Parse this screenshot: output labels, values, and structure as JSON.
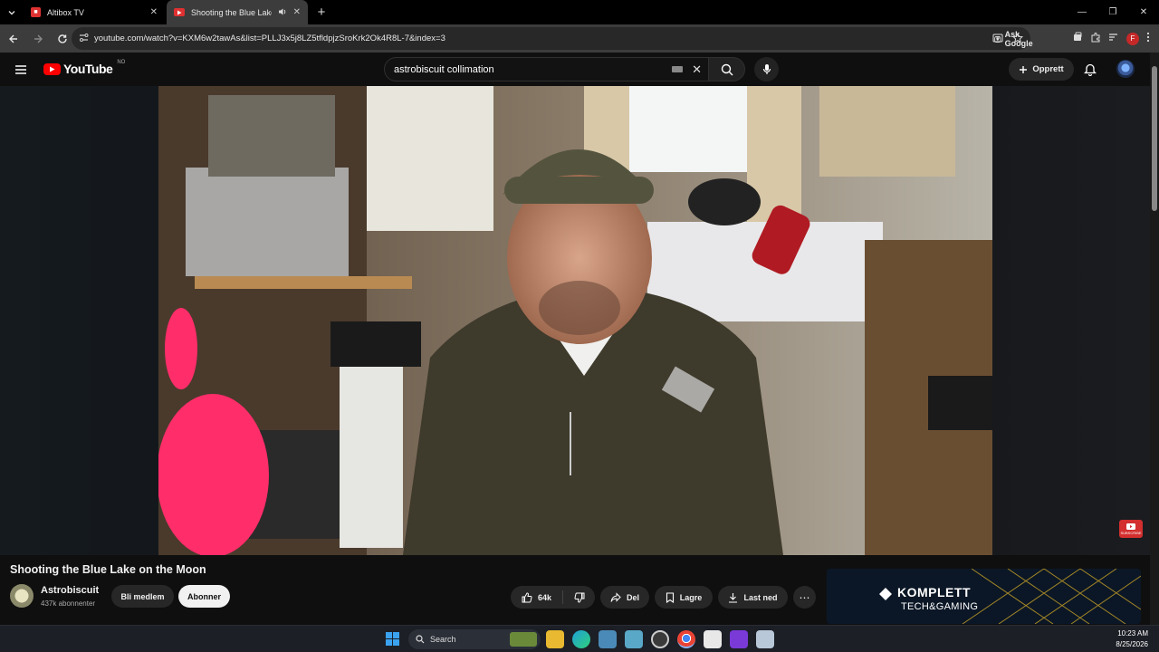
{
  "browser": {
    "tabs": [
      {
        "title": "Altibox TV",
        "active": false
      },
      {
        "title": "Shooting the Blue Lake on",
        "active": true
      }
    ],
    "url": "youtube.com/watch?v=KXM6w2tawAs&list=PLLJ3x5j8LZ5tfldpjzSroKrk2Ok4R8L-7&index=3",
    "ask_google_label": "Ask Google",
    "profile_initial": "F"
  },
  "youtube": {
    "logo_text": "YouTube",
    "country_code": "NO",
    "search_value": "astrobiscuit collimation",
    "create_label": "Opprett"
  },
  "video": {
    "title": "Shooting the Blue Lake on the Moon",
    "watermark_label": "SUBSCRIBE"
  },
  "channel": {
    "name": "Astrobiscuit",
    "subscribers": "437k abonnenter",
    "member_label": "Bli medlem",
    "subscribe_label": "Abonner"
  },
  "actions": {
    "likes": "64k",
    "share_label": "Del",
    "save_label": "Lagre",
    "download_label": "Last ned"
  },
  "ad": {
    "brand": "KOMPLETT",
    "tagline": "TECH&GAMING"
  },
  "taskbar": {
    "search_label": "Search",
    "time": "10:23 AM",
    "date": "8/25/2026"
  }
}
